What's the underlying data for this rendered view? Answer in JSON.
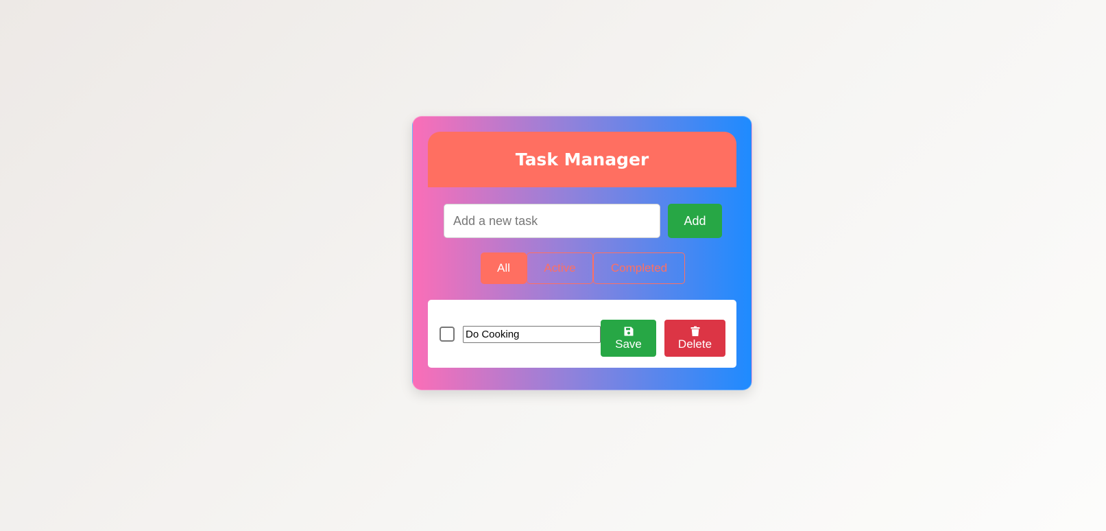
{
  "app": {
    "title": "Task Manager"
  },
  "new_task": {
    "placeholder": "Add a new task",
    "value": "",
    "add_label": "Add"
  },
  "filters": {
    "items": [
      {
        "label": "All",
        "selected": true
      },
      {
        "label": "Active",
        "selected": false
      },
      {
        "label": "Completed",
        "selected": false
      }
    ]
  },
  "tasks": [
    {
      "checked": false,
      "text": "Do Cooking",
      "editing": true,
      "save_label": "Save",
      "save_icon": "floppy-disk-icon",
      "delete_label": "Delete",
      "delete_icon": "trash-icon"
    }
  ],
  "colors": {
    "header": "#ff6f61",
    "accent": "#ff6f61",
    "success": "#27a745",
    "danger": "#dc3545",
    "gradient_start": "#fb6eb7",
    "gradient_end": "#1e8bff"
  }
}
